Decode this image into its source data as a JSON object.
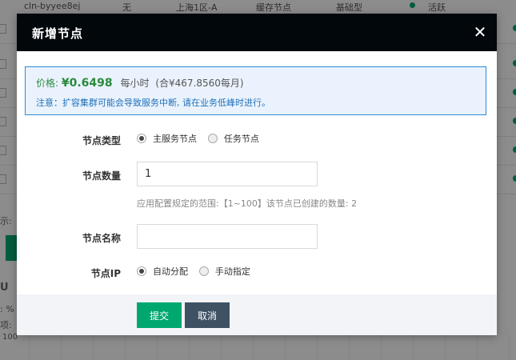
{
  "background": {
    "top_row": [
      "cln-byyee8ej",
      "无",
      "上海1区-A",
      "缓存节点",
      "基础型",
      "活跃"
    ],
    "left_fragments": [
      "示:",
      "U",
      ": %",
      "项:",
      "100"
    ]
  },
  "modal": {
    "title": "新增节点",
    "close_symbol": "✕",
    "price": {
      "label": "价格:",
      "value": "¥0.6498",
      "per_hour": "每小时",
      "per_month": "(合¥467.8560每月)"
    },
    "warning": "注意：扩容集群可能会导致服务中断, 请在业务低峰时进行。",
    "form": {
      "node_type": {
        "label": "节点类型",
        "options": [
          {
            "label": "主服务节点",
            "checked": true
          },
          {
            "label": "任务节点",
            "checked": false
          }
        ]
      },
      "node_count": {
        "label": "节点数量",
        "value": "1",
        "hint": "应用配置规定的范围:【1~100】该节点已创建的数量: 2"
      },
      "node_name": {
        "label": "节点名称",
        "value": ""
      },
      "node_ip": {
        "label": "节点IP",
        "options": [
          {
            "label": "自动分配",
            "checked": true
          },
          {
            "label": "手动指定",
            "checked": false
          }
        ]
      }
    },
    "buttons": {
      "submit": "提交",
      "cancel": "取消"
    }
  },
  "colors": {
    "header_bg": "#02070c",
    "primary": "#00a870",
    "secondary": "#3f5264",
    "notice_border": "#2a8ad7",
    "notice_bg": "#eaf3fd"
  }
}
